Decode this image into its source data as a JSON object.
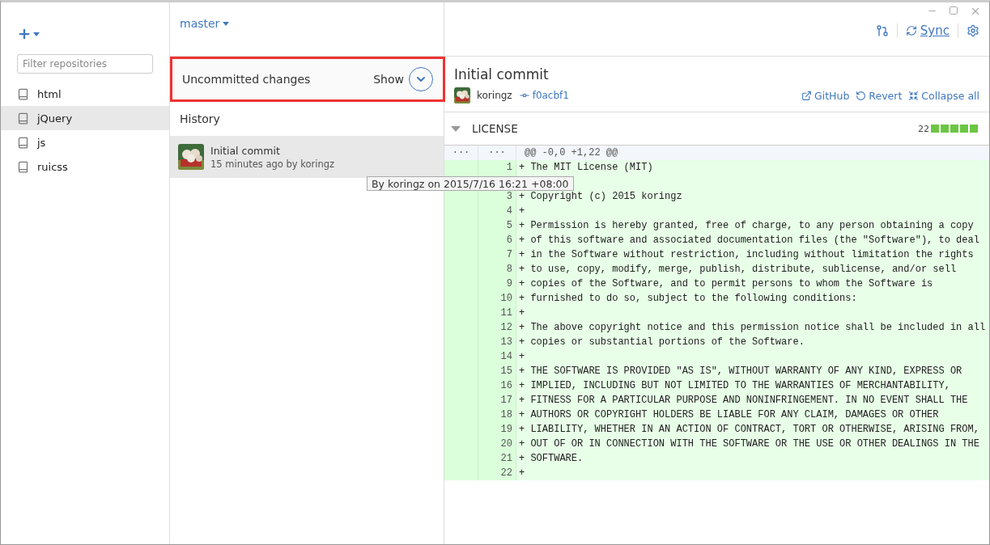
{
  "sidebar": {
    "filter": {
      "placeholder": "Filter repositories"
    },
    "repositories": [
      {
        "name": "html",
        "selected": false
      },
      {
        "name": "jQuery",
        "selected": true
      },
      {
        "name": "js",
        "selected": false
      },
      {
        "name": "ruicss",
        "selected": false
      }
    ]
  },
  "branch": "master",
  "toolbar": {
    "sync": "Sync"
  },
  "uncommitted": {
    "title": "Uncommitted changes",
    "show": "Show",
    "highlighted": true
  },
  "history": {
    "title": "History",
    "commits": [
      {
        "title": "Initial commit",
        "meta": "15 minutes ago by koringz",
        "selected": true
      }
    ]
  },
  "tooltip": "By koringz on 2015/7/16 16:21 +08:00",
  "commit": {
    "title": "Initial commit",
    "author": "koringz",
    "sha": "f0acbf1",
    "actions": [
      "GitHub",
      "Revert",
      "Collapse all"
    ]
  },
  "file": {
    "name": "LICENSE",
    "additions": "22",
    "expanded": true,
    "hunk_left": "···",
    "hunk_right": "···",
    "hunk": "@@ -0,0 +1,22 @@",
    "lines": [
      {
        "kind": "added",
        "num": "1",
        "text": "+ The MIT License (MIT)"
      },
      {
        "kind": "covered"
      },
      {
        "kind": "added",
        "num": "3",
        "text": "+ Copyright (c) 2015 koringz"
      },
      {
        "kind": "added",
        "num": "4",
        "text": "+"
      },
      {
        "kind": "added",
        "num": "5",
        "text": "+ Permission is hereby granted, free of charge, to any person obtaining a copy"
      },
      {
        "kind": "added",
        "num": "6",
        "text": "+ of this software and associated documentation files (the \"Software\"), to deal"
      },
      {
        "kind": "added",
        "num": "7",
        "text": "+ in the Software without restriction, including without limitation the rights"
      },
      {
        "kind": "added",
        "num": "8",
        "text": "+ to use, copy, modify, merge, publish, distribute, sublicense, and/or sell"
      },
      {
        "kind": "added",
        "num": "9",
        "text": "+ copies of the Software, and to permit persons to whom the Software is"
      },
      {
        "kind": "added",
        "num": "10",
        "text": "+ furnished to do so, subject to the following conditions:"
      },
      {
        "kind": "added",
        "num": "11",
        "text": "+"
      },
      {
        "kind": "added",
        "num": "12",
        "text": "+ The above copyright notice and this permission notice shall be included in all"
      },
      {
        "kind": "added",
        "num": "13",
        "text": "+ copies or substantial portions of the Software."
      },
      {
        "kind": "added",
        "num": "14",
        "text": "+"
      },
      {
        "kind": "added",
        "num": "15",
        "text": "+ THE SOFTWARE IS PROVIDED \"AS IS\", WITHOUT WARRANTY OF ANY KIND, EXPRESS OR"
      },
      {
        "kind": "added",
        "num": "16",
        "text": "+ IMPLIED, INCLUDING BUT NOT LIMITED TO THE WARRANTIES OF MERCHANTABILITY,"
      },
      {
        "kind": "added",
        "num": "17",
        "text": "+ FITNESS FOR A PARTICULAR PURPOSE AND NONINFRINGEMENT. IN NO EVENT SHALL THE"
      },
      {
        "kind": "added",
        "num": "18",
        "text": "+ AUTHORS OR COPYRIGHT HOLDERS BE LIABLE FOR ANY CLAIM, DAMAGES OR OTHER"
      },
      {
        "kind": "added",
        "num": "19",
        "text": "+ LIABILITY, WHETHER IN AN ACTION OF CONTRACT, TORT OR OTHERWISE, ARISING FROM,"
      },
      {
        "kind": "added",
        "num": "20",
        "text": "+ OUT OF OR IN CONNECTION WITH THE SOFTWARE OR THE USE OR OTHER DEALINGS IN THE"
      },
      {
        "kind": "added",
        "num": "21",
        "text": "+ SOFTWARE."
      },
      {
        "kind": "added",
        "num": "22",
        "text": "+"
      }
    ]
  }
}
